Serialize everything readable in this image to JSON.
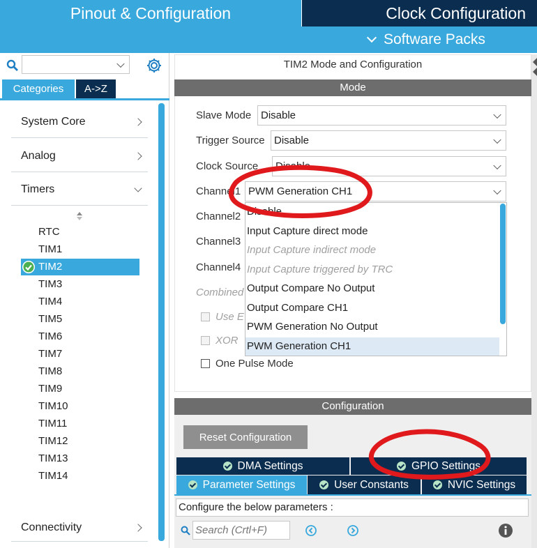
{
  "header": {
    "pinout_tab": "Pinout & Configuration",
    "clock_tab": "Clock Configuration",
    "software_packs": "Software Packs"
  },
  "sidebar": {
    "tabs": [
      "Categories",
      "A->Z"
    ],
    "categories": [
      "System Core",
      "Analog",
      "Timers",
      "Connectivity"
    ],
    "timers": [
      "RTC",
      "TIM1",
      "TIM2",
      "TIM3",
      "TIM4",
      "TIM5",
      "TIM6",
      "TIM7",
      "TIM8",
      "TIM9",
      "TIM10",
      "TIM11",
      "TIM12",
      "TIM13",
      "TIM14"
    ],
    "selected_timer": "TIM2"
  },
  "mode_panel": {
    "title": "TIM2 Mode and Configuration",
    "section": "Mode",
    "slave_mode_label": "Slave Mode",
    "slave_mode_value": "Disable",
    "trigger_source_label": "Trigger Source",
    "trigger_source_value": "Disable",
    "clock_source_label": "Clock Source",
    "clock_source_value": "Disable",
    "channel1_label": "Channel1",
    "channel1_value": "PWM Generation CH1",
    "channel2_label": "Channel2",
    "channel3_label": "Channel3",
    "channel4_label": "Channel4",
    "combined_label": "Combined",
    "use_label": "Use E",
    "xor_label": "XOR",
    "one_pulse_label": "One Pulse Mode"
  },
  "dropdown": {
    "options": [
      {
        "label": "Disable",
        "disabled": false
      },
      {
        "label": "Input Capture direct mode",
        "disabled": false
      },
      {
        "label": "Input Capture indirect mode",
        "disabled": true
      },
      {
        "label": "Input Capture triggered by TRC",
        "disabled": true
      },
      {
        "label": "Output Compare No Output",
        "disabled": false
      },
      {
        "label": "Output Compare CH1",
        "disabled": false
      },
      {
        "label": "PWM Generation No Output",
        "disabled": false
      },
      {
        "label": "PWM Generation CH1",
        "disabled": false,
        "selected": true
      }
    ]
  },
  "config_panel": {
    "section": "Configuration",
    "reset_button": "Reset Configuration",
    "tabs_row1": [
      "DMA Settings",
      "GPIO Settings"
    ],
    "tabs_row2": [
      "Parameter Settings",
      "User Constants",
      "NVIC Settings"
    ],
    "configure_text": "Configure the below parameters :",
    "search_placeholder": "Search (Crtl+F)"
  },
  "colors": {
    "header_blue": "#39a8dc",
    "header_dark": "#0b2d4f",
    "section_gray": "#6d6d6d",
    "selected_row": "#39a8dc",
    "annotation_red": "#e0191d"
  },
  "icons": [
    "search-icon",
    "gear-icon",
    "check-icon",
    "info-icon",
    "prev-icon",
    "next-icon"
  ]
}
